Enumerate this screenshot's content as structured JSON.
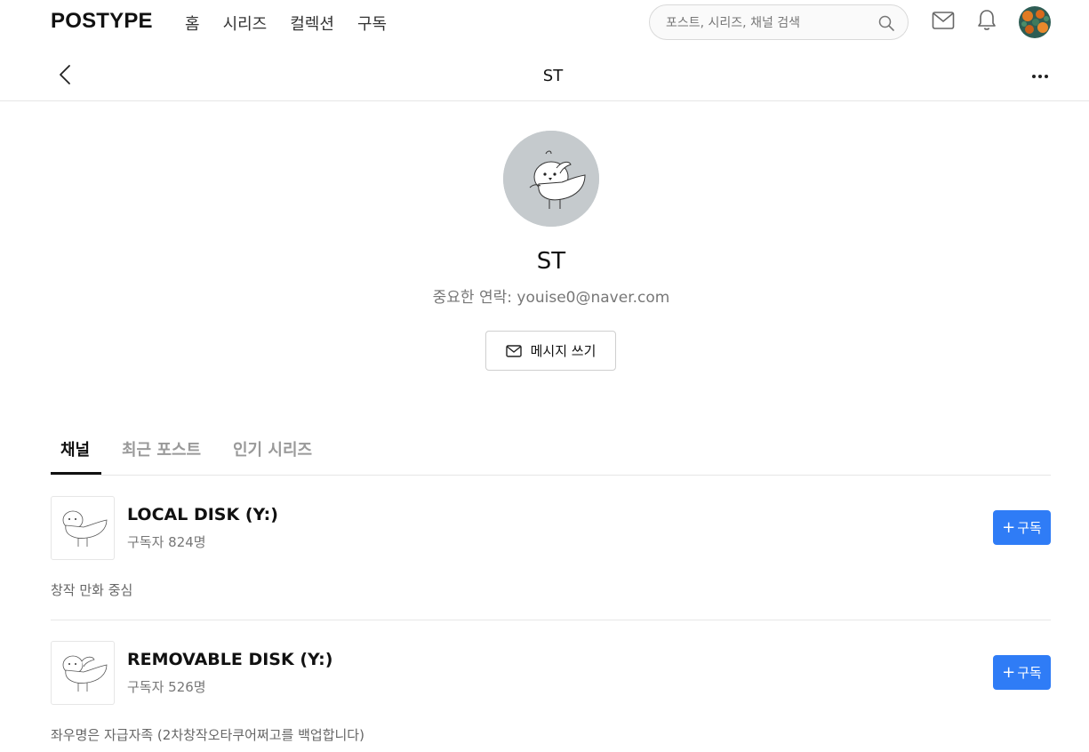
{
  "nav": {
    "logo": "POSTYPE",
    "links": [
      "홈",
      "시리즈",
      "컬렉션",
      "구독"
    ],
    "search_placeholder": "포스트, 시리즈, 채널 검색",
    "search_icon": "search-icon",
    "mail_icon": "mail-icon",
    "bell_icon": "bell-icon"
  },
  "subheader": {
    "title": "ST",
    "back_icon": "chevron-left-icon",
    "more_icon": "more-icon"
  },
  "profile": {
    "name": "ST",
    "description": "중요한 연락: youise0@naver.com",
    "message_button": "메시지 쓰기"
  },
  "tabs": [
    {
      "label": "채널",
      "active": true
    },
    {
      "label": "최근 포스트",
      "active": false
    },
    {
      "label": "인기 시리즈",
      "active": false
    }
  ],
  "channels": [
    {
      "title": "LOCAL DISK (Y:)",
      "subscribers": "구독자 824명",
      "subscribe_label": "구독",
      "description": "창작 만화 중심"
    },
    {
      "title": "REMOVABLE DISK (Y:)",
      "subscribers": "구독자 526명",
      "subscribe_label": "구독",
      "description": "좌우명은 자급자족 (2차창작오타쿠어쩌고를 백업합니다)"
    }
  ],
  "colors": {
    "accent": "#2f7cf6",
    "avatar_bg": "#c5cacd"
  }
}
